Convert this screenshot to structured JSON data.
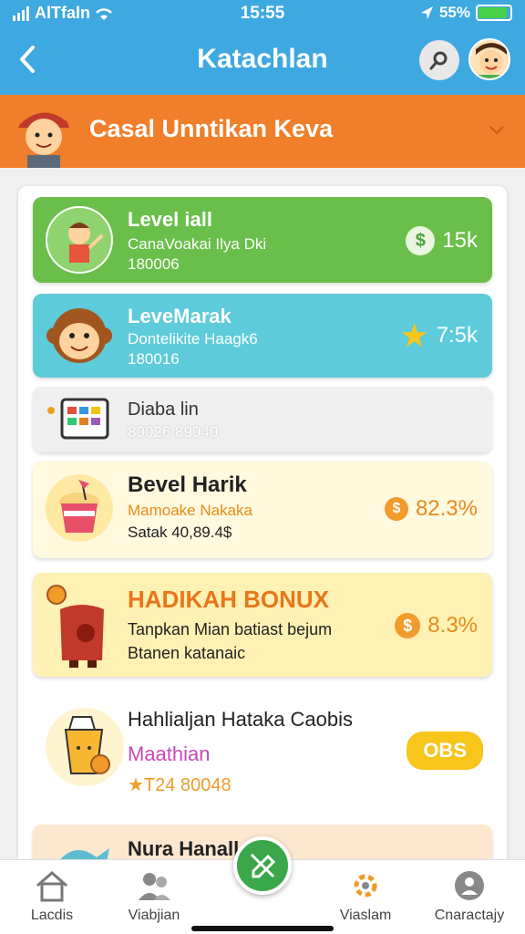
{
  "status": {
    "carrier": "AlTfaln",
    "time": "15:55",
    "battery": "55%"
  },
  "header": {
    "title": "Katachlan",
    "back_icon": "chevron-left-icon"
  },
  "banner": {
    "text": "Casal Unntikan Keva"
  },
  "cards": [
    {
      "title": "Level iall",
      "sub": "CanaVoakai Ilya Dki",
      "extra": "180006",
      "value": "15k",
      "badge": "$"
    },
    {
      "title": "LeveMarak",
      "sub": "Dontelikite Haagk6",
      "extra": "180016",
      "value": "7:5k",
      "badge": "★"
    },
    {
      "title": "Diaba lin",
      "sub": "80026 89040"
    },
    {
      "title": "Bevel Harik",
      "sub": "Mamoake Nakaka",
      "extra": "Satak 40,89.4$",
      "value": "82.3%",
      "badge": "$"
    },
    {
      "title": "HADIKAH BONUX",
      "sub": "Tanpkan Mian batiast bejum",
      "extra": "Btanen katanaic",
      "value": "8.3%",
      "badge": "$"
    },
    {
      "title": "Hahlialjan Hataka Caobis",
      "sub": "Maathian",
      "extra": "★T24 80048",
      "value": "OBS"
    },
    {
      "title": "Nura Hanallam"
    }
  ],
  "nav": [
    {
      "label": "Lacdis"
    },
    {
      "label": "Viabjian"
    },
    {
      "label": "Viaslam"
    },
    {
      "label": "Cnaractajy"
    }
  ],
  "colors": {
    "header": "#3ea8e0",
    "banner": "#f07e2a",
    "green": "#6abf4b",
    "teal": "#5dcbd9",
    "orange": "#e88a1a"
  }
}
